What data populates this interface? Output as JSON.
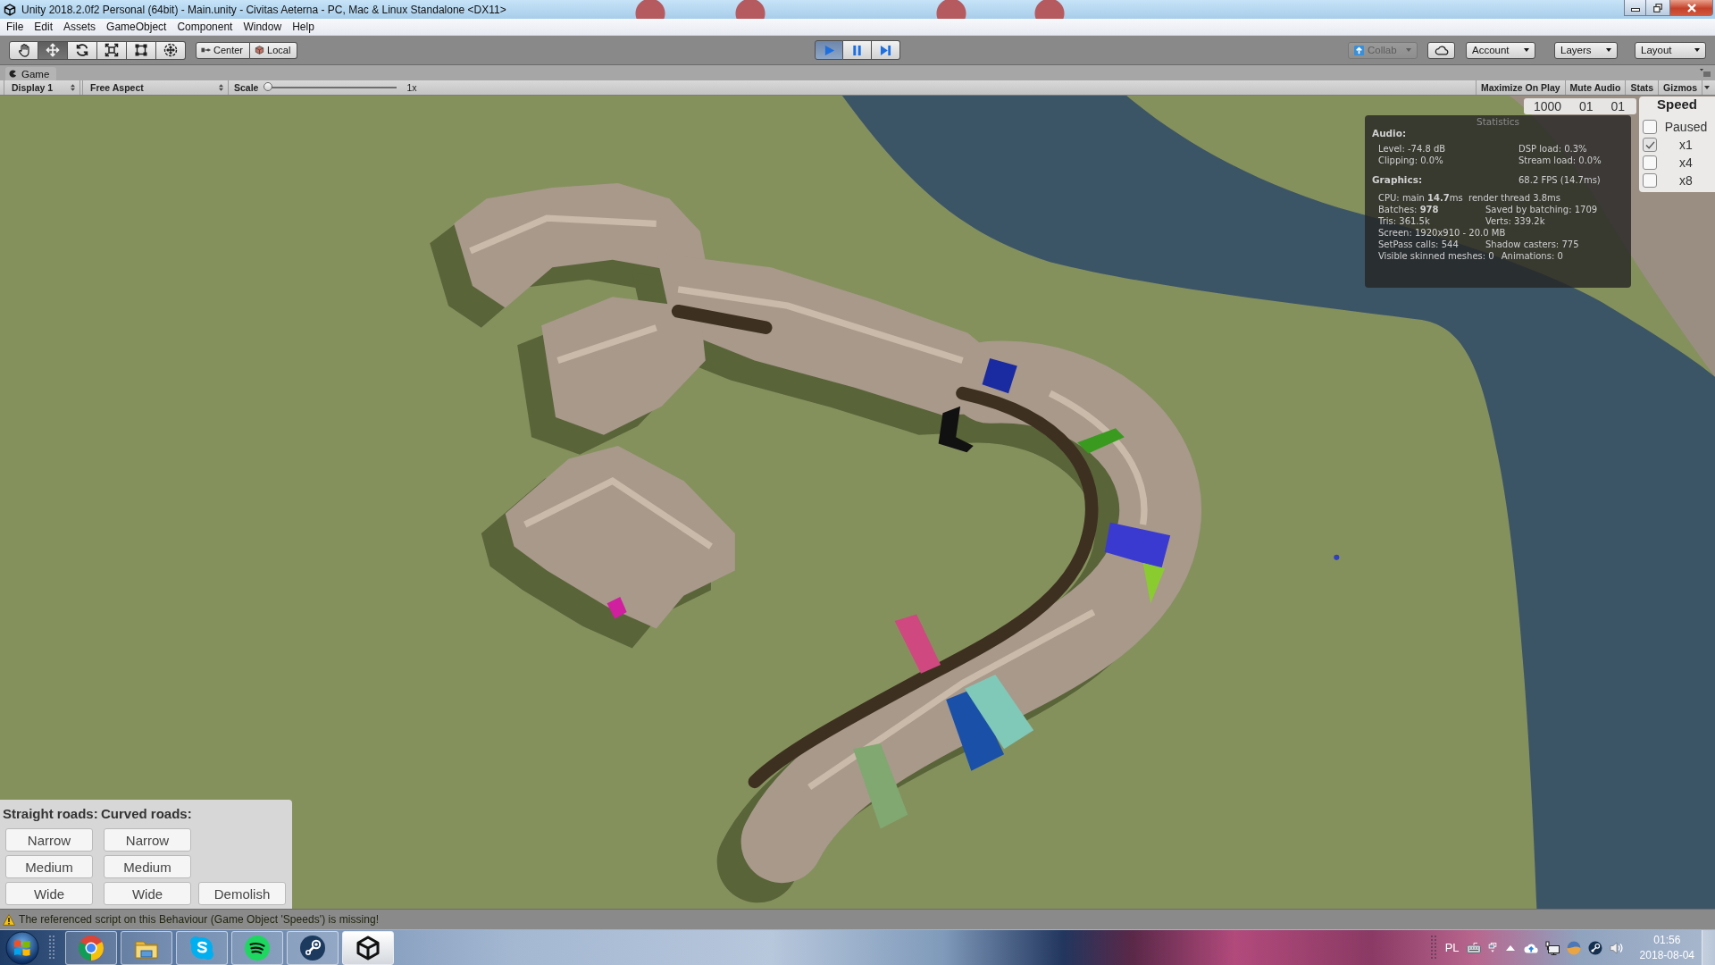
{
  "window": {
    "title": "Unity 2018.2.0f2 Personal (64bit) - Main.unity - Civitas Aeterna - PC, Mac & Linux Standalone <DX11>"
  },
  "menu": [
    "File",
    "Edit",
    "Assets",
    "GameObject",
    "Component",
    "Window",
    "Help"
  ],
  "toolbar": {
    "tools": [
      {
        "kind": "hand",
        "selected": false
      },
      {
        "kind": "move",
        "selected": true
      },
      {
        "kind": "rotate",
        "selected": false
      },
      {
        "kind": "scale",
        "selected": false
      },
      {
        "kind": "rect",
        "selected": false
      },
      {
        "kind": "transform",
        "selected": false
      }
    ],
    "pivot": [
      {
        "kind": "center",
        "label": "Center"
      },
      {
        "kind": "local",
        "label": "Local"
      }
    ],
    "playback": [
      {
        "kind": "play",
        "on": true
      },
      {
        "kind": "pause",
        "on": false
      },
      {
        "kind": "step",
        "on": false
      }
    ],
    "collab": {
      "label": "Collab",
      "disabled": true
    },
    "menus": [
      {
        "label": "Account"
      },
      {
        "label": "Layers"
      },
      {
        "label": "Layout"
      }
    ]
  },
  "game_panel": {
    "tab": "Game",
    "display": "Display 1",
    "aspect": "Free Aspect",
    "scale": {
      "label": "Scale",
      "level": 0,
      "reading": "1x"
    },
    "toggles": [
      {
        "label": "Maximize On Play",
        "kind": "toggle"
      },
      {
        "label": "Mute Audio",
        "kind": "toggle"
      },
      {
        "label": "Stats",
        "kind": "toggle"
      },
      {
        "label": "Gizmos",
        "kind": "dropdown"
      }
    ]
  },
  "date": {
    "year": "1000",
    "month": "01",
    "day": "01"
  },
  "speed": {
    "title": "Speed",
    "options": [
      {
        "label": "Paused",
        "checked": false
      },
      {
        "label": "x1",
        "checked": true
      },
      {
        "label": "x4",
        "checked": false
      },
      {
        "label": "x8",
        "checked": false
      }
    ]
  },
  "statistics": {
    "title": "Statistics",
    "audio": {
      "heading": "Audio:",
      "rows": [
        [
          "Level: -74.8 dB",
          "DSP load: 0.3%"
        ],
        [
          "Clipping: 0.0%",
          "Stream load: 0.0%"
        ]
      ]
    },
    "graphics": {
      "heading": "Graphics:",
      "fps": "68.2 FPS (14.7ms)",
      "rows": [
        [
          "CPU: main **14.7**ms  render thread 3.8ms"
        ],
        [
          "Batches: **978**",
          "Saved by batching: 1709"
        ],
        [
          "Tris: 361.5k",
          "Verts: 339.2k"
        ],
        [
          "Screen: 1920x910 - 20.0 MB"
        ],
        [
          "SetPass calls: 544",
          "Shadow casters: 775"
        ],
        [
          "Visible skinned meshes: 0",
          "Animations: 0"
        ]
      ]
    }
  },
  "road_panel": {
    "columns": [
      {
        "heading": "Straight roads:",
        "buttons": [
          "Narrow",
          "Medium",
          "Wide"
        ]
      },
      {
        "heading": "Curved roads:",
        "buttons": [
          "Narrow",
          "Medium",
          "Wide"
        ]
      },
      {
        "buttons": [
          "Demolish"
        ]
      }
    ]
  },
  "status_bar": {
    "kind": "warning",
    "message": "The referenced script on this Behaviour (Game Object 'Speeds') is missing!"
  },
  "taskbar": {
    "apps": [
      {
        "kind": "chrome",
        "selected": false
      },
      {
        "kind": "explorer",
        "selected": false
      },
      {
        "kind": "skype",
        "selected": false
      },
      {
        "kind": "spotify",
        "selected": false
      },
      {
        "kind": "steam",
        "selected": false
      },
      {
        "kind": "unity",
        "selected": true
      }
    ],
    "language": "PL",
    "time": "01:56",
    "date": "2018-08-04"
  }
}
